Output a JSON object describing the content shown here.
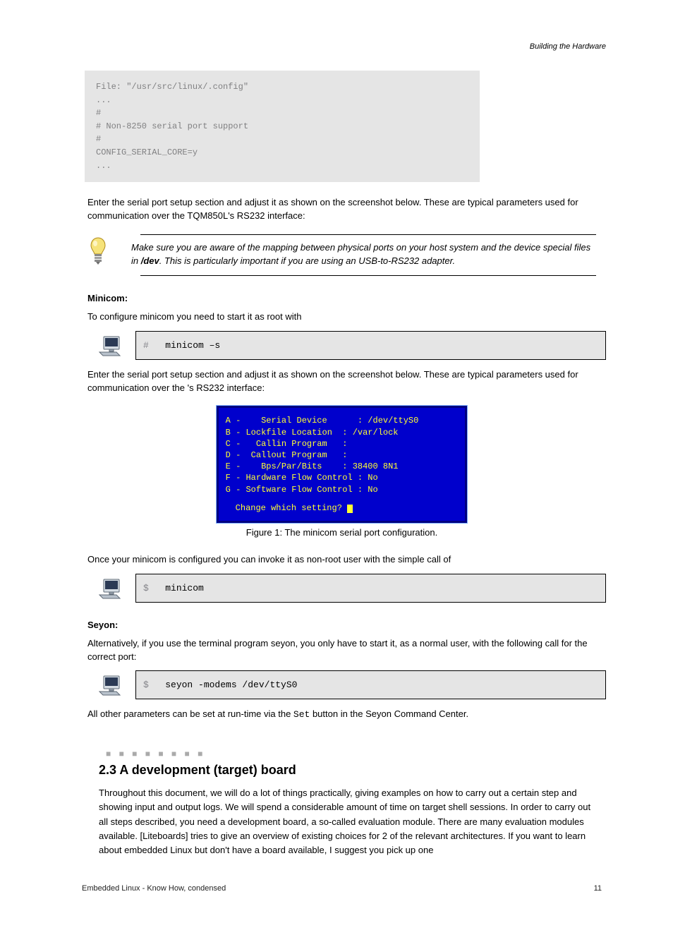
{
  "pagehead": "Building the Hardware",
  "greybox_lines": [
    "File: \"/usr/src/linux/.config\"",
    "...",
    "#",
    "# Non-8250 serial port support",
    "#",
    "CONFIG_SERIAL_CORE=y",
    "..."
  ],
  "para1": "Enter the serial port setup section and adjust it as shown on the screenshot below. These are typical parameters used for communication over the TQM850L's RS232 interface:",
  "hint_text_prefix": "Make sure you are aware of the mapping between physical ports on your host system and the device special files in ",
  "hint_path": "/dev",
  "hint_text_suffix": ". This is particularly important if you are using an USB-to-RS232 adapter.",
  "heading_minicom": "Minicom:",
  "para_minicom": "To configure minicom you need to start it as root with",
  "cmd1": {
    "prompt": "#",
    "text": "minicom –s"
  },
  "para_after_cmd1": "Enter the serial port setup section and adjust it as shown on the screenshot below. These are typical parameters used for communication over the 's RS232 interface:",
  "blue": {
    "rows": [
      {
        "k": "A -    Serial Device      ",
        "v": ": /dev/ttyS0"
      },
      {
        "k": "B - Lockfile Location  ",
        "v": ": /var/lock"
      },
      {
        "k": "C -   Callin Program   ",
        "v": ":"
      },
      {
        "k": "D -  Callout Program   ",
        "v": ":"
      },
      {
        "k": "E -    Bps/Par/Bits    ",
        "v": ": 38400 8N1"
      },
      {
        "k": "F - Hardware Flow Control ",
        "v": ": No"
      },
      {
        "k": "G - Software Flow Control ",
        "v": ": No"
      }
    ],
    "prompt": "Change which setting? "
  },
  "figcap": "Figure 1: The minicom serial port configuration.",
  "para2": "Once your minicom is configured you can invoke it as non-root user with the simple call of",
  "cmd2": {
    "prompt": "$",
    "text": "minicom"
  },
  "heading_seyon": "Seyon:",
  "para_seyon": "Alternatively, if you use the terminal program seyon, you only have to start it, as a normal user, with the following call for the correct port:",
  "cmd3": {
    "prompt": "$",
    "text": "seyon -modems /dev/ttyS0"
  },
  "para3_a": "All other parameters can be set at run-time via the ",
  "para3_code": "Set",
  "para3_b": " button in the Seyon Command Center.",
  "sep": "■ ■ ■ ■ ■ ■ ■ ■",
  "sectnum": "2.3  A development (target) board",
  "sect_para": "Throughout this document, we will do a lot of things practically, giving examples on how to carry out a certain step and showing input and output logs. We will spend a considerable amount of time on target shell sessions. In order to carry out all steps described, you need a development board, a so-called evaluation module. There are many evaluation modules available. [Liteboards] tries to give an overview of existing choices for 2 of the relevant architectures. If you want to learn about embedded Linux but don't have a board available, I suggest you pick up one",
  "footer_left": "Embedded Linux - Know How, condensed",
  "footer_right": "11"
}
